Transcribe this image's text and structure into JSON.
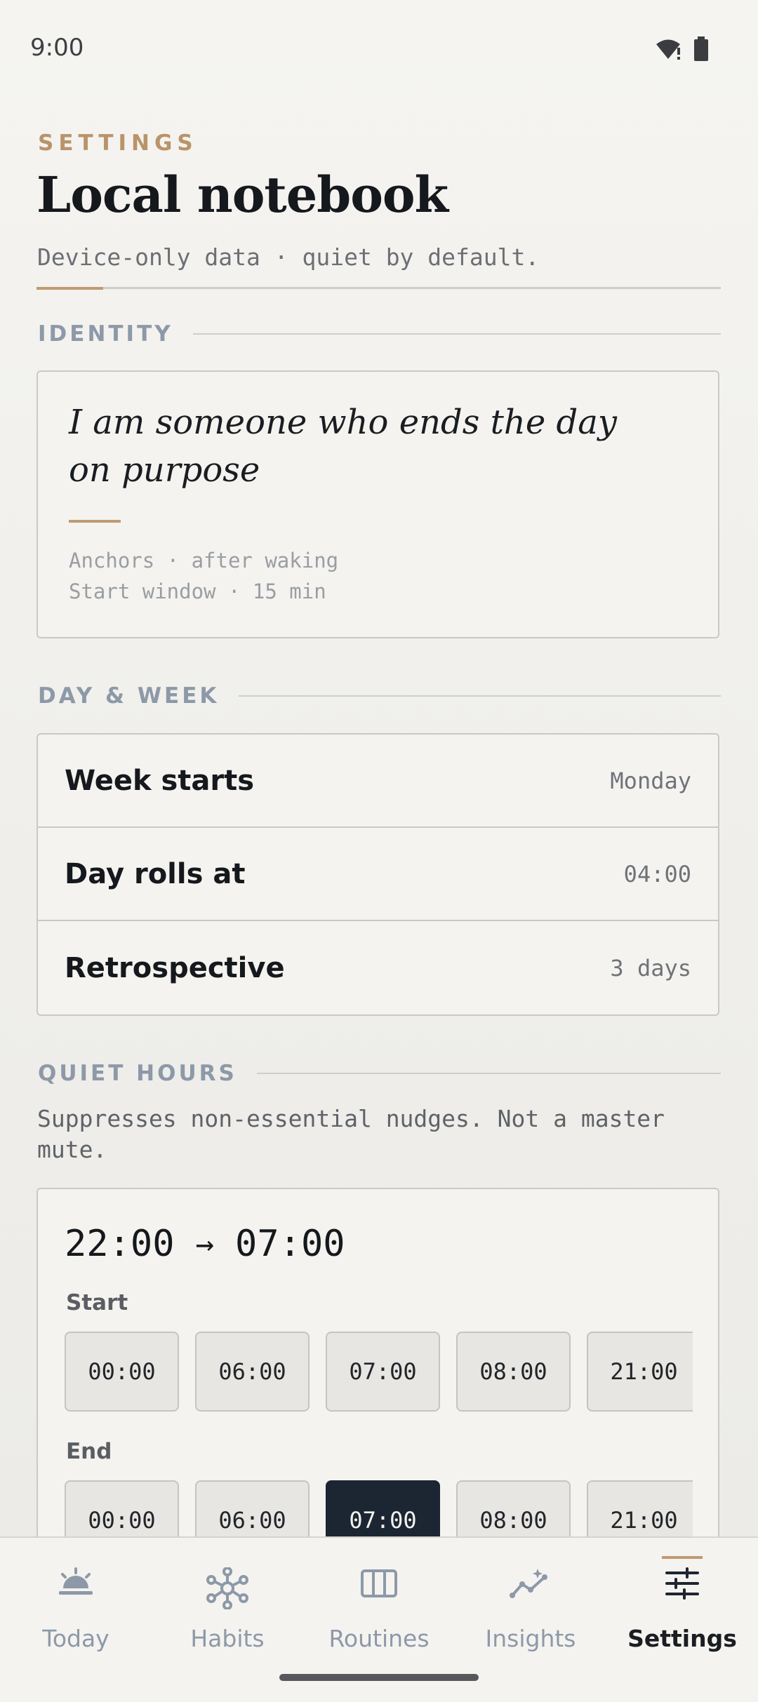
{
  "status": {
    "time": "9:00"
  },
  "header": {
    "eyebrow": "SETTINGS",
    "title": "Local notebook",
    "subtitle": "Device-only data · quiet by default."
  },
  "identity": {
    "section": "IDENTITY",
    "statement": "I am someone who ends the day on purpose",
    "anchors": "Anchors · after waking",
    "window": "Start window · 15 min"
  },
  "dayweek": {
    "section": "DAY & WEEK",
    "rows": [
      {
        "label": "Week starts",
        "value": "Monday"
      },
      {
        "label": "Day rolls at",
        "value": "04:00"
      },
      {
        "label": "Retrospective",
        "value": "3 days"
      }
    ]
  },
  "quiet": {
    "section": "QUIET HOURS",
    "description": "Suppresses non-essential nudges. Not a master mute.",
    "start_time": "22:00",
    "arrow": "→",
    "end_time": "07:00",
    "start_label": "Start",
    "end_label": "End",
    "start_options": [
      "00:00",
      "06:00",
      "07:00",
      "08:00",
      "21:00"
    ],
    "end_options": [
      "00:00",
      "06:00",
      "07:00",
      "08:00",
      "21:00"
    ],
    "end_selected": "07:00"
  },
  "nav": {
    "tabs": [
      {
        "label": "Today",
        "icon": "sunrise-icon"
      },
      {
        "label": "Habits",
        "icon": "network-icon"
      },
      {
        "label": "Routines",
        "icon": "columns-icon"
      },
      {
        "label": "Insights",
        "icon": "trend-sparkle-icon"
      },
      {
        "label": "Settings",
        "icon": "sliders-icon"
      }
    ],
    "active": "Settings"
  },
  "colors": {
    "accent": "#c09a72",
    "selected": "#1c2633",
    "muted": "#8d99a8"
  }
}
